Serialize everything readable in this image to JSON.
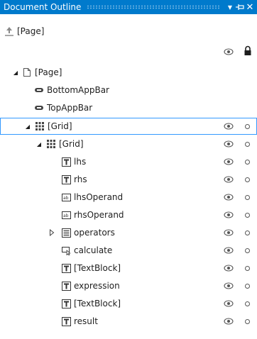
{
  "window": {
    "title": "Document Outline",
    "buttons": {
      "dropdown": "▼",
      "pin": "⊣",
      "close": "✕"
    }
  },
  "toolbar": {
    "up_icon": "navigate-up-icon",
    "page_label": "[Page]"
  },
  "tree": [
    {
      "label": "[Page]",
      "icon": "page-icon",
      "expanded": true
    },
    {
      "label": "BottomAppBar",
      "icon": "appbar-icon"
    },
    {
      "label": "TopAppBar",
      "icon": "appbar-icon"
    },
    {
      "label": "[Grid]",
      "icon": "grid-icon",
      "expanded": true,
      "selected": true
    },
    {
      "label": "[Grid]",
      "icon": "grid-icon",
      "expanded": true
    },
    {
      "label": "lhs",
      "icon": "textblock-icon"
    },
    {
      "label": "rhs",
      "icon": "textblock-icon"
    },
    {
      "label": "lhsOperand",
      "icon": "textbox-icon"
    },
    {
      "label": "rhsOperand",
      "icon": "textbox-icon"
    },
    {
      "label": "operators",
      "icon": "listbox-icon",
      "expanded": false
    },
    {
      "label": "calculate",
      "icon": "button-icon"
    },
    {
      "label": "[TextBlock]",
      "icon": "textblock-icon"
    },
    {
      "label": "expression",
      "icon": "textblock-icon"
    },
    {
      "label": "[TextBlock]",
      "icon": "textblock-icon"
    },
    {
      "label": "result",
      "icon": "textblock-icon"
    }
  ]
}
